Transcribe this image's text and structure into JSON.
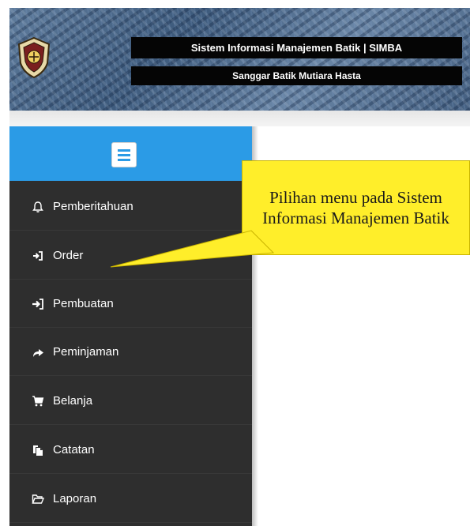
{
  "header": {
    "title": "Sistem Informasi Manajemen Batik | SIMBA",
    "subtitle": "Sanggar Batik Mutiara Hasta"
  },
  "sidebar": {
    "accent_color": "#2b9be6",
    "background_color": "#2e2e2e",
    "toggle_icon": "hamburger-icon",
    "items": [
      {
        "label": "Pemberitahuan",
        "icon": "bell-icon"
      },
      {
        "label": "Order",
        "icon": "sign-in-icon"
      },
      {
        "label": "Pembuatan",
        "icon": "log-in-icon"
      },
      {
        "label": "Peminjaman",
        "icon": "share-arrow-icon"
      },
      {
        "label": "Belanja",
        "icon": "cart-icon"
      },
      {
        "label": "Catatan",
        "icon": "copy-icon"
      },
      {
        "label": "Laporan",
        "icon": "folder-open-icon"
      }
    ]
  },
  "callout": {
    "text": "Pilihan menu pada Sistem Informasi Manajemen Batik",
    "color": "#ffee2a"
  }
}
